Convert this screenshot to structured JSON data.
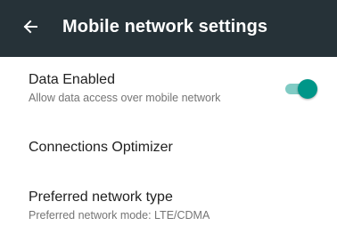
{
  "appbar": {
    "title": "Mobile network settings",
    "back_icon": "arrow-left-icon",
    "background": "#263238"
  },
  "settings": [
    {
      "title": "Data Enabled",
      "subtitle": "Allow data access over mobile network",
      "toggle": {
        "on": true,
        "accent": "#009688"
      }
    },
    {
      "title": "Connections Optimizer"
    },
    {
      "title": "Preferred network type",
      "subtitle": "Preferred network mode: LTE/CDMA"
    }
  ]
}
